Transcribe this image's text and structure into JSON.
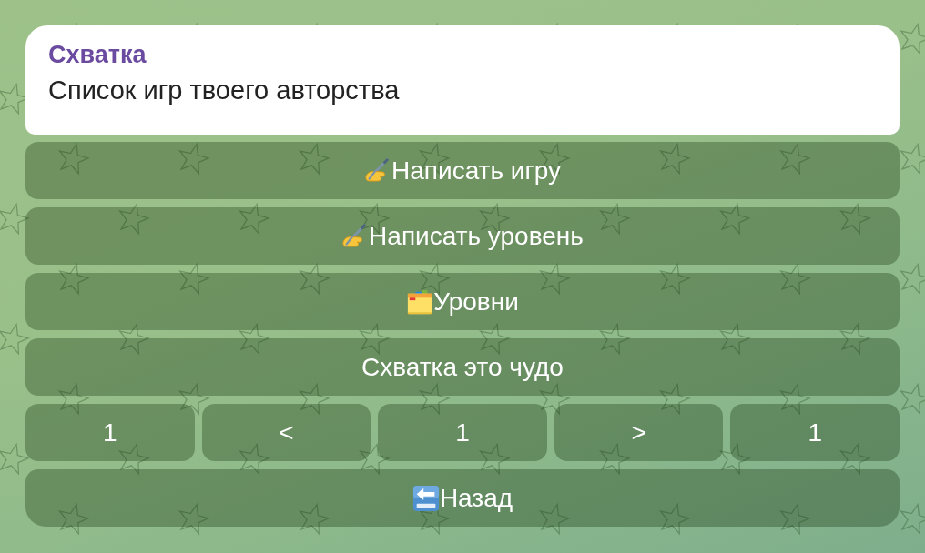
{
  "message": {
    "sender": "Схватка",
    "text": "Список игр твоего авторства"
  },
  "keyboard": {
    "rows": [
      {
        "buttons": [
          {
            "label": "Написать игру",
            "kind": "write"
          }
        ]
      },
      {
        "buttons": [
          {
            "label": "Написать уровень",
            "kind": "write"
          }
        ]
      },
      {
        "buttons": [
          {
            "label": "Уровни",
            "kind": "folder"
          }
        ]
      },
      {
        "buttons": [
          {
            "label": "Схватка это чудо",
            "kind": "plain"
          }
        ]
      },
      {
        "buttons": [
          {
            "label": "1",
            "kind": "plain"
          },
          {
            "label": "<",
            "kind": "plain"
          },
          {
            "label": "1",
            "kind": "plain"
          },
          {
            "label": ">",
            "kind": "plain"
          },
          {
            "label": "1",
            "kind": "plain"
          }
        ]
      },
      {
        "buttons": [
          {
            "label": "Назад",
            "kind": "back"
          }
        ]
      }
    ]
  }
}
